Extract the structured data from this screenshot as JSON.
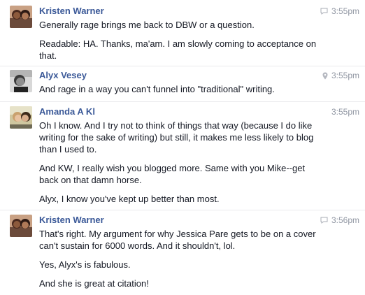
{
  "messages": [
    {
      "sender": "Kristen Warner",
      "time": "3:55pm",
      "meta_icon": "chat-bubble-icon",
      "lines": [
        "Generally rage brings me back to DBW or a question.",
        "Readable: HA. Thanks, ma'am. I am slowly coming to acceptance on that."
      ]
    },
    {
      "sender": "Alyx Vesey",
      "time": "3:55pm",
      "meta_icon": "location-pin-icon",
      "lines": [
        "And rage in a way you can't funnel into \"traditional\" writing."
      ]
    },
    {
      "sender": "Amanda A Kl",
      "time": "3:55pm",
      "meta_icon": "",
      "lines": [
        "Oh I know. And I try not to think of things that way (because I do like writing for the sake of writing) but still, it makes me less likely to blog than I used to.",
        "And KW, I really wish you blogged more. Same with you Mike--get back on that damn horse.",
        "Alyx, I know you've kept up better than most."
      ]
    },
    {
      "sender": "Kristen Warner",
      "time": "3:56pm",
      "meta_icon": "chat-bubble-icon",
      "lines": [
        "That's right. My argument for why Jessica Pare gets to be on a cover can't sustain for 6000 words. And it shouldn't, lol.",
        "Yes, Alyx's is fabulous.",
        "And she is great at citation!"
      ]
    }
  ]
}
